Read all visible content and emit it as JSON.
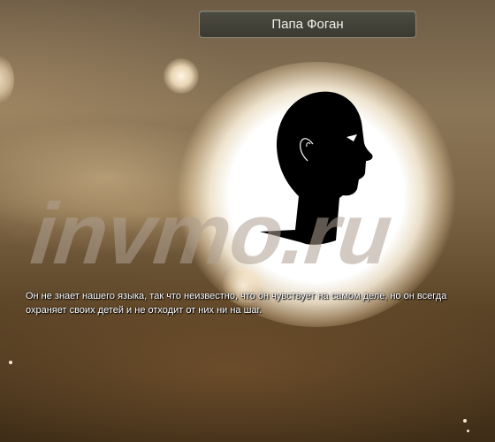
{
  "dialog": {
    "title": "Папа Фоган",
    "description": "Он не знает нашего языка, так что неизвестно, что он чувствует на самом деле, но он всегда охраняет своих детей и не отходит от них ни на шаг."
  },
  "portrait": {
    "icon": "head-silhouette-icon"
  },
  "watermark": {
    "text": "invmo.ru"
  },
  "colors": {
    "background_top": "#6e5c46",
    "background_bottom": "#3e2c17",
    "glow": "#ffffff",
    "title_bar": "#3b3a31",
    "title_border": "#8a8778",
    "text": "#ffffff",
    "silhouette": "#000000"
  }
}
